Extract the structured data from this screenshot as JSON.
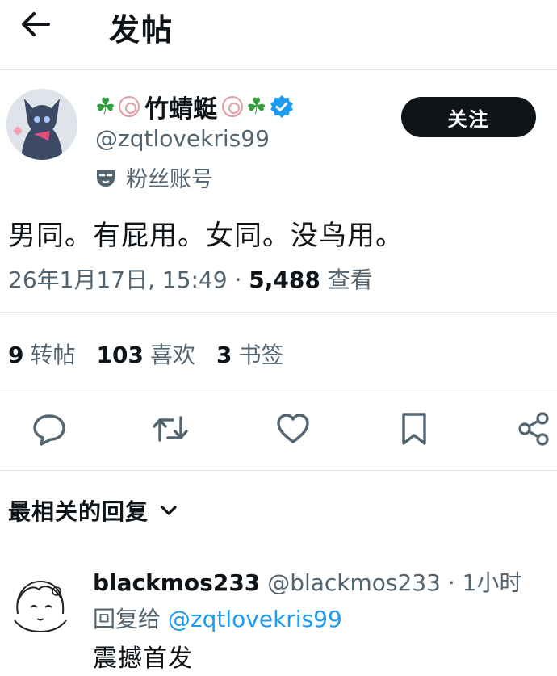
{
  "header": {
    "title": "发帖"
  },
  "author": {
    "name": "竹蜻蜓",
    "handle": "@zqtlovekris99",
    "fan_label": "粉丝账号",
    "follow_label": "关注"
  },
  "tweet": {
    "text": "男同。有屁用。女同。没鸟用。",
    "datetime": "26年1月17日, 15:49",
    "separator": "·",
    "views_count": "5,488",
    "views_label": "查看"
  },
  "stats": {
    "retweets_count": "9",
    "retweets_label": "转帖",
    "likes_count": "103",
    "likes_label": "喜欢",
    "bookmarks_count": "3",
    "bookmarks_label": "书签"
  },
  "replies": {
    "sort_label": "最相关的回复",
    "items": [
      {
        "name": "blackmos233",
        "handle": "@blackmos233",
        "separator": "·",
        "time": "1小时",
        "reply_to_label": "回复给",
        "reply_to_handle": "@zqtlovekris99",
        "text": "震撼首发"
      }
    ]
  },
  "icons": {
    "back": "arrow-left-icon",
    "verified": "verified-badge-icon",
    "fan": "mask-icon",
    "reply": "reply-icon",
    "retweet": "retweet-icon",
    "like": "heart-icon",
    "bookmark": "bookmark-icon",
    "share": "share-icon",
    "chevron": "chevron-down-icon"
  },
  "colors": {
    "text": "#0f1419",
    "secondary": "#536471",
    "accent": "#1d9bf0",
    "divider": "#e3e6e8"
  }
}
